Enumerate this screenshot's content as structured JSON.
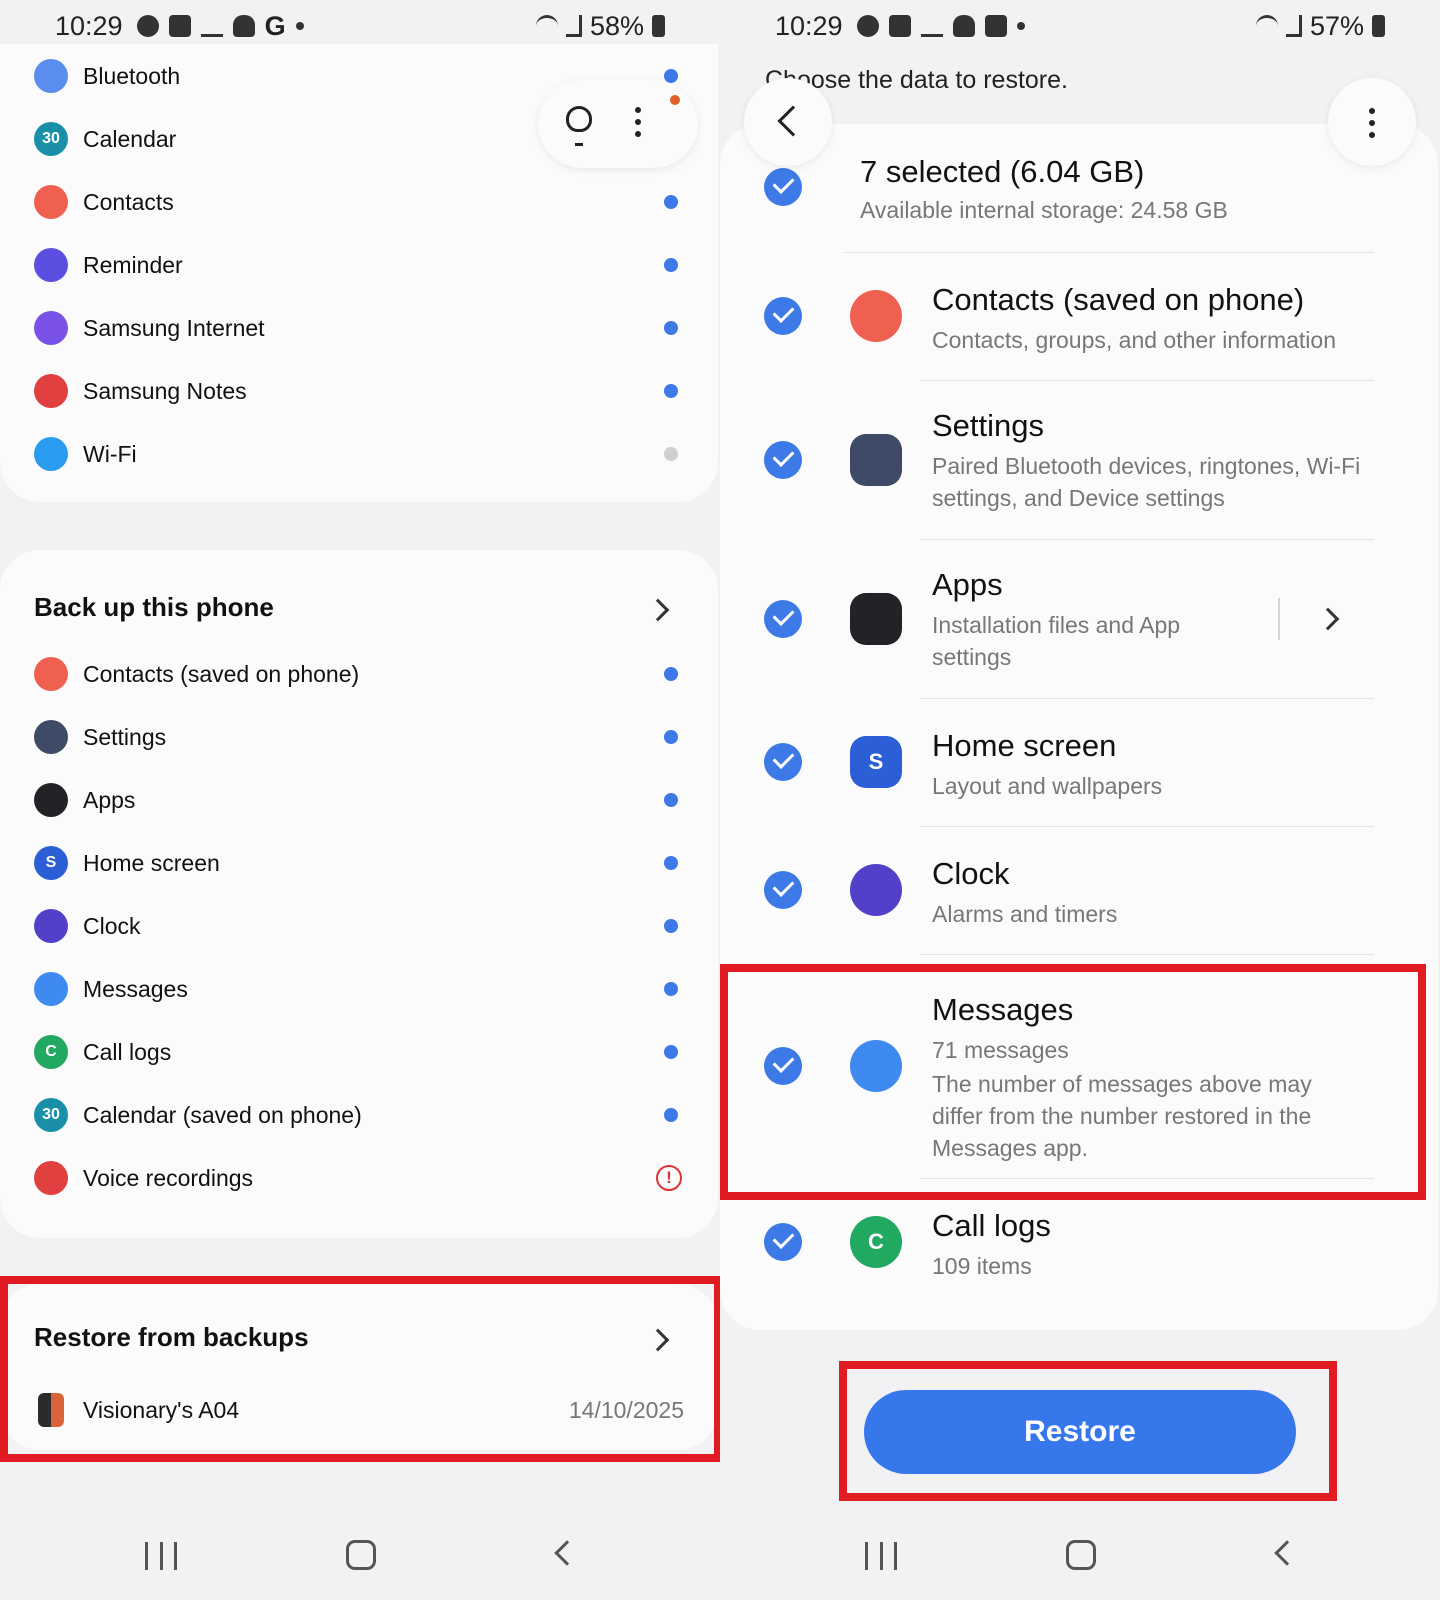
{
  "left": {
    "status": {
      "time": "10:29",
      "battery": "58%"
    },
    "top_list": [
      {
        "label": "Bluetooth",
        "icon": "bluetooth-icon",
        "color": "#5b8cf0",
        "dot": "blue"
      },
      {
        "label": "Calendar",
        "icon": "calendar-icon",
        "color": "#1a8fa8",
        "glyph": "30",
        "dot": "none"
      },
      {
        "label": "Contacts",
        "icon": "contacts-icon",
        "color": "#f06050",
        "dot": "blue"
      },
      {
        "label": "Reminder",
        "icon": "reminder-icon",
        "color": "#5a4fe0",
        "dot": "blue"
      },
      {
        "label": "Samsung Internet",
        "icon": "samsung-internet-icon",
        "color": "#7a52e8",
        "dot": "blue"
      },
      {
        "label": "Samsung Notes",
        "icon": "samsung-notes-icon",
        "color": "#e04040",
        "dot": "blue"
      },
      {
        "label": "Wi-Fi",
        "icon": "wifi-icon",
        "color": "#2a9cf0",
        "dot": "gray"
      }
    ],
    "backup": {
      "title": "Back up this phone",
      "items": [
        {
          "label": "Contacts (saved on phone)",
          "icon": "contacts-icon",
          "color": "#f06050",
          "dot": "blue"
        },
        {
          "label": "Settings",
          "icon": "settings-icon",
          "color": "#3e4a66",
          "dot": "blue"
        },
        {
          "label": "Apps",
          "icon": "apps-icon",
          "color": "#222326",
          "dot": "blue"
        },
        {
          "label": "Home screen",
          "icon": "home-screen-icon",
          "color": "#2c5fd6",
          "glyph": "S",
          "dot": "blue"
        },
        {
          "label": "Clock",
          "icon": "clock-icon",
          "color": "#5340c8",
          "dot": "blue"
        },
        {
          "label": "Messages",
          "icon": "messages-icon",
          "color": "#3e8af0",
          "dot": "blue"
        },
        {
          "label": "Call logs",
          "icon": "call-logs-icon",
          "color": "#21a861",
          "glyph": "C",
          "dot": "blue"
        },
        {
          "label": "Calendar (saved on phone)",
          "icon": "calendar-icon",
          "color": "#1a8fa8",
          "glyph": "30",
          "dot": "blue"
        },
        {
          "label": "Voice recordings",
          "icon": "voice-recordings-icon",
          "color": "#e04040",
          "dot": "warning",
          "warn_glyph": "!"
        }
      ]
    },
    "restore": {
      "title": "Restore from backups",
      "device": "Visionary's A04",
      "date": "14/10/2025"
    }
  },
  "right": {
    "status": {
      "time": "10:29",
      "battery": "57%"
    },
    "hint": "Choose the data to restore.",
    "summary": {
      "title": "7 selected (6.04 GB)",
      "sub": "Available internal storage: 24.58 GB"
    },
    "items": [
      {
        "title": "Contacts (saved on phone)",
        "sub": "Contacts, groups, and other information",
        "icon": "contacts-icon",
        "color": "#f06050"
      },
      {
        "title": "Settings",
        "sub": "Paired Bluetooth devices, ringtones, Wi-Fi settings, and Device settings",
        "icon": "settings-icon",
        "color": "#3e4a66"
      },
      {
        "title": "Apps",
        "sub": "Installation files and App settings",
        "icon": "apps-icon",
        "color": "#222326"
      },
      {
        "title": "Home screen",
        "sub": "Layout and wallpapers",
        "icon": "home-screen-icon",
        "color": "#2c5fd6",
        "glyph": "S"
      },
      {
        "title": "Clock",
        "sub": "Alarms and timers",
        "icon": "clock-icon",
        "color": "#5340c8"
      },
      {
        "title": "Messages",
        "sub": "71 messages",
        "sub2": "The number of messages above may differ from the number restored in the Messages app.",
        "icon": "messages-icon",
        "color": "#3e8af0"
      },
      {
        "title": "Call logs",
        "sub": "109 items",
        "icon": "call-logs-icon",
        "color": "#21a861",
        "glyph": "C"
      }
    ],
    "restore_button": "Restore"
  },
  "colors": {
    "accent": "#3777ec",
    "highlight": "#e01b22",
    "check": "#3d7ae8"
  }
}
